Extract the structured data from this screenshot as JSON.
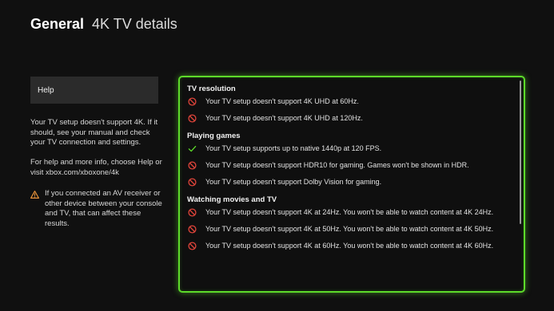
{
  "header": {
    "section": "General",
    "page": "4K TV details"
  },
  "sidebar": {
    "help_label": "Help",
    "paragraph1": "Your TV setup doesn't support 4K. If it should, see your manual and check your TV connection and settings.",
    "paragraph2": "For help and more info, choose Help or visit xbox.com/xboxone/4k",
    "warning": "If you connected an AV receiver or other device between your console and TV, that can affect these results."
  },
  "details": {
    "sections": [
      {
        "heading": "TV resolution",
        "items": [
          {
            "status": "no",
            "text": "Your TV setup doesn't support 4K UHD at 60Hz."
          },
          {
            "status": "no",
            "text": "Your TV setup doesn't support 4K UHD at 120Hz."
          }
        ]
      },
      {
        "heading": "Playing games",
        "items": [
          {
            "status": "yes",
            "text": "Your TV setup supports up to native 1440p at 120 FPS."
          },
          {
            "status": "no",
            "text": "Your TV setup doesn't support HDR10 for gaming. Games won't be shown in HDR."
          },
          {
            "status": "no",
            "text": "Your TV setup doesn't support Dolby Vision for gaming."
          }
        ]
      },
      {
        "heading": "Watching movies and TV",
        "items": [
          {
            "status": "no",
            "text": "Your TV setup doesn't support 4K at 24Hz. You won't be able to watch content at 4K 24Hz."
          },
          {
            "status": "no",
            "text": "Your TV setup doesn't support 4K at 50Hz. You won't be able to watch content at 4K 50Hz."
          },
          {
            "status": "no",
            "text": "Your TV setup doesn't support 4K at 60Hz. You won't be able to watch content at 4K 60Hz."
          }
        ]
      }
    ]
  },
  "colors": {
    "focus_border": "#5ddb2a",
    "not_supported": "#e0443a",
    "supported": "#5ddb2a",
    "warning": "#e8923a"
  },
  "icons": {
    "not_supported": "prohibited-icon",
    "supported": "checkmark-icon",
    "warning": "warning-triangle-icon"
  }
}
